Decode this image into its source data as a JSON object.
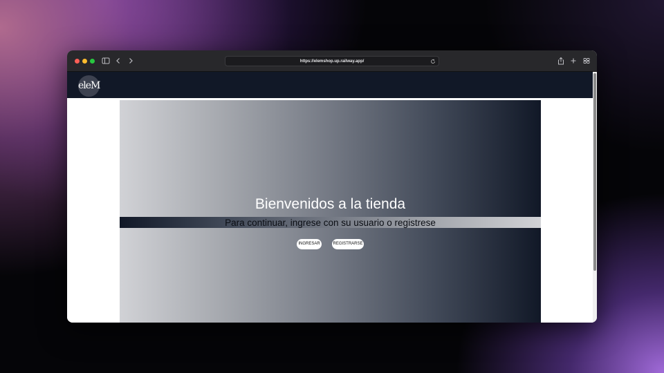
{
  "browser": {
    "url": "https://elemshop.up.railway.app/"
  },
  "navbar": {
    "logo_text": "eleM"
  },
  "hero": {
    "title": "Bienvenidos a la tienda",
    "subtitle": "Para continuar, ingrese con su usuario o registrese",
    "login_button": "INGRESAR",
    "register_button": "REGISTRARSE"
  },
  "colors": {
    "navbar": "#111827",
    "gradient_light": "#d1d2d6",
    "gradient_dark": "#111827",
    "button_bg": "#ffffff"
  }
}
